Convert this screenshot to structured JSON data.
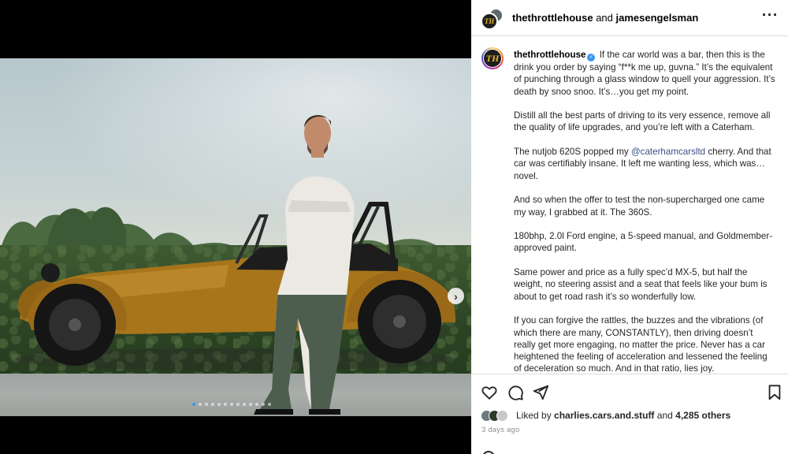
{
  "header": {
    "account_primary": "thethrottlehouse",
    "joiner": "and",
    "account_collab": "jamesengelsman",
    "more_icon": "more-options-icon"
  },
  "avatar_monogram": "TH",
  "caption": {
    "username": "thethrottlehouse",
    "para1": "If the car world was a bar, then this is the drink you order by saying “f**k me up, guvna.” It’s the equivalent of punching through a glass window to quell your aggression. It’s death by snoo snoo. It’s…you get my point.",
    "para2": "Distill all the best parts of driving to its very essence, remove all the quality of life upgrades, and you’re left with a Caterham.",
    "para3_before": "The nutjob 620S popped my ",
    "para3_mention": "@caterhamcarsltd",
    "para3_after": " cherry. And that car was certifiably insane. It left me wanting less, which was… novel.",
    "para4": "And so when the offer to test the non-supercharged one came my way, I grabbed at it. The 360S.",
    "para5": "180bhp, 2.0l Ford engine, a 5-speed manual, and Goldmember-approved paint.",
    "para6": "Same power and price as a fully spec’d MX-5, but half the weight, no steering assist and a seat that feels like your bum is about to get road rash it’s so wonderfully low.",
    "para7": "If you can forgive the rattles, the buzzes and the vibrations (of which there are many, CONSTANTLY), then driving doesn’t really get more engaging, no matter the price. Never has a car heightened the feeling of acceleration and lessened the feeling of deceleration so much. And in that ratio, lies joy."
  },
  "likes": {
    "prefix": "Liked by",
    "user": "charlies.cars.and.stuff",
    "and": "and",
    "others": "4,285 others"
  },
  "timestamp": "3 days ago",
  "carousel": {
    "slide_count": 13,
    "active_index": 0
  },
  "colors": {
    "accent_blue": "#3797f0",
    "car_gold": "#a8751b",
    "mention": "#385185"
  }
}
